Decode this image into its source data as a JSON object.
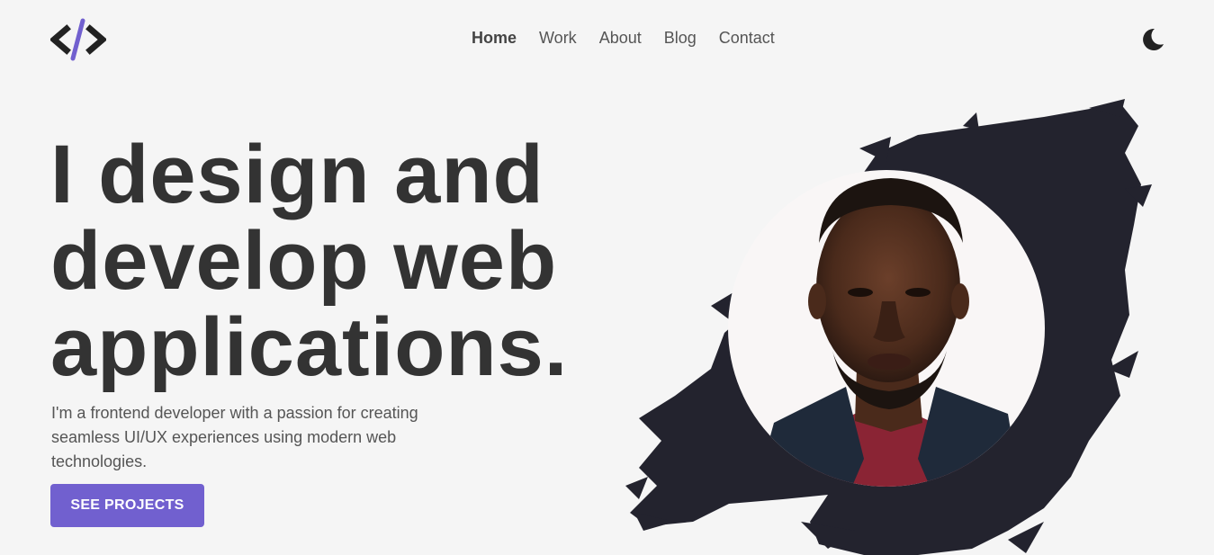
{
  "header": {
    "logo_icon": "code-brackets-icon",
    "nav": [
      {
        "label": "Home",
        "active": true
      },
      {
        "label": "Work",
        "active": false
      },
      {
        "label": "About",
        "active": false
      },
      {
        "label": "Blog",
        "active": false
      },
      {
        "label": "Contact",
        "active": false
      }
    ],
    "theme_toggle_icon": "moon-icon"
  },
  "hero": {
    "title_line1": "I design and",
    "title_line2": "develop web",
    "title_line3": "applications.",
    "subtitle": "I'm a frontend developer with a passion for creating seamless UI/UX experiences using modern web technologies.",
    "cta_label": "SEE PROJECTS"
  },
  "colors": {
    "background": "#f5f5f5",
    "accent": "#7160cf",
    "text": "#333333",
    "brush": "#23232e"
  }
}
